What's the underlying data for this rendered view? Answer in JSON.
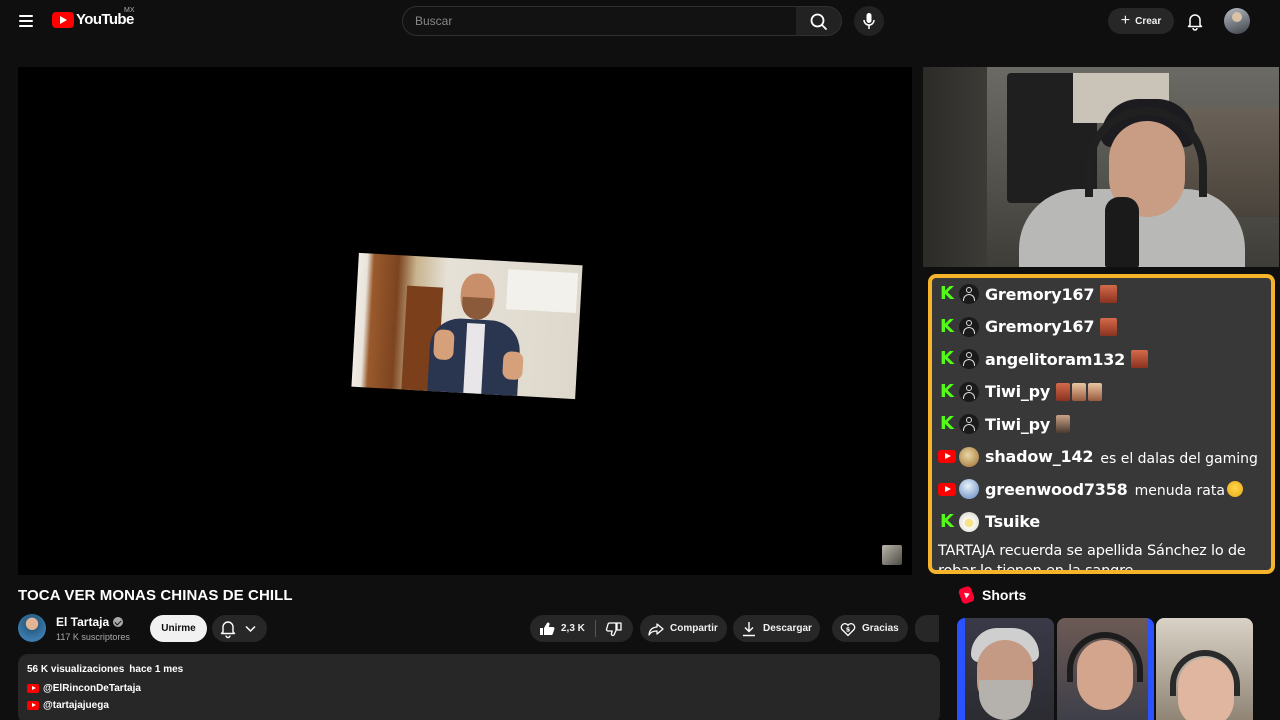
{
  "header": {
    "logo_text": "YouTube",
    "country_code": "MX",
    "search_placeholder": "Buscar",
    "create_label": "Crear"
  },
  "chat": {
    "messages": [
      {
        "platform": "kick",
        "avatar": "default-user",
        "username": "Gremory167",
        "text": "",
        "emotes": 1
      },
      {
        "platform": "kick",
        "avatar": "default-user",
        "username": "Gremory167",
        "text": "",
        "emotes": 1
      },
      {
        "platform": "kick",
        "avatar": "default-user",
        "username": "angelitoram132",
        "text": "",
        "emotes": 1
      },
      {
        "platform": "kick",
        "avatar": "default-user",
        "username": "Tiwi_py",
        "text": "",
        "emotes": 3
      },
      {
        "platform": "kick",
        "avatar": "default-user",
        "username": "Tiwi_py",
        "text": "",
        "emotes": 1
      },
      {
        "platform": "youtube",
        "avatar": "doge",
        "username": "shadow_142",
        "text": "es el dalas del gaming",
        "emotes": 0
      },
      {
        "platform": "youtube",
        "avatar": "earth",
        "username": "greenwood7358",
        "text": "menuda rata",
        "emotes": 1
      },
      {
        "platform": "kick",
        "avatar": "egg",
        "username": "Tsuike",
        "text": "",
        "emotes": 0
      }
    ],
    "long_message": "TARTAJA recuerda se apellida Sánchez lo de robar lo tienen en la sangre",
    "border_color": "#f5b429",
    "kick_color": "#53fc18"
  },
  "video": {
    "title": "TOCA VER MONAS CHINAS DE CHILL",
    "channel_name": "El Tartaja",
    "subscribers": "117 K suscriptores",
    "join_label": "Unirme",
    "like_count": "2,3 K",
    "share_label": "Compartir",
    "download_label": "Descargar",
    "thanks_label": "Gracias"
  },
  "description": {
    "views": "56 K visualizaciones",
    "date": "hace 1 mes",
    "links": [
      "@ElRinconDeTartaja",
      "@tartajajuega"
    ]
  },
  "shorts": {
    "label": "Shorts"
  },
  "colors": {
    "background": "#0f0f0f",
    "youtube_red": "#ff0000",
    "pill": "#272727"
  }
}
